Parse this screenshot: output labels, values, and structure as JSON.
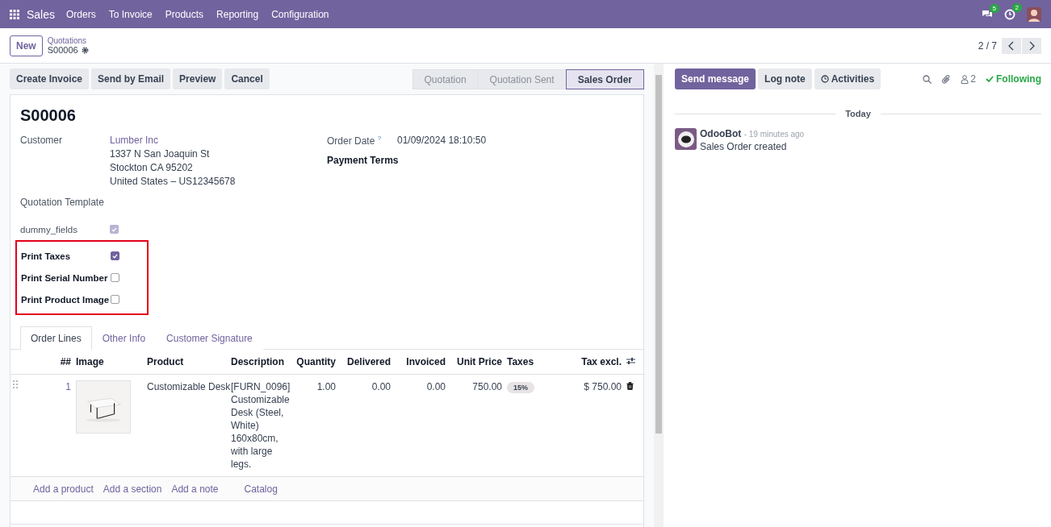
{
  "navbar": {
    "app": "Sales",
    "menu": [
      "Orders",
      "To Invoice",
      "Products",
      "Reporting",
      "Configuration"
    ],
    "messages_badge": "5",
    "activities_badge": "2"
  },
  "control_panel": {
    "new_button": "New",
    "breadcrumb": "Quotations",
    "record": "S00006",
    "pager": "2 / 7"
  },
  "actions": [
    "Create Invoice",
    "Send by Email",
    "Preview",
    "Cancel"
  ],
  "status_bar": [
    {
      "label": "Quotation",
      "selected": false
    },
    {
      "label": "Quotation Sent",
      "selected": false
    },
    {
      "label": "Sales Order",
      "selected": true
    }
  ],
  "form": {
    "title": "S00006",
    "customer": {
      "label": "Customer",
      "name": "Lumber Inc",
      "address": [
        "1337 N San Joaquin St",
        "Stockton CA 95202",
        "United States – US12345678"
      ]
    },
    "order_date": {
      "label": "Order Date",
      "help": "?",
      "value": "01/09/2024 18:10:50"
    },
    "payment_terms": {
      "label": "Payment Terms"
    },
    "quotation_template": {
      "label": "Quotation Template"
    },
    "checkbox_fields": [
      {
        "label": "dummy_fields",
        "checked": true,
        "disabled": true
      }
    ],
    "highlighted_fields": [
      {
        "label": "Print Taxes",
        "checked": true
      },
      {
        "label": "Print Serial Number",
        "checked": false
      },
      {
        "label": "Print Product Image",
        "checked": false
      }
    ],
    "tabs": [
      {
        "label": "Order Lines",
        "selected": true
      },
      {
        "label": "Other Info",
        "selected": false
      },
      {
        "label": "Customer Signature",
        "selected": false
      }
    ],
    "table": {
      "columns": [
        "##",
        "Image",
        "Product",
        "Description",
        "Quantity",
        "Delivered",
        "Invoiced",
        "Unit Price",
        "Taxes",
        "Tax excl."
      ],
      "rows": [
        {
          "number": "1",
          "product": "Customizable Desk",
          "description": "[FURN_0096] Customizable Desk (Steel, White) 160x80cm, with large legs.",
          "quantity": "1.00",
          "delivered": "0.00",
          "invoiced": "0.00",
          "unit_price": "750.00",
          "taxes": "15%",
          "tax_excl": "$ 750.00"
        }
      ],
      "add_links": [
        "Add a product",
        "Add a section",
        "Add a note",
        "Catalog"
      ]
    }
  },
  "chatter": {
    "buttons": [
      {
        "label": "Send message",
        "selected": true
      },
      {
        "label": "Log note",
        "selected": false
      },
      {
        "label": "Activities",
        "selected": false
      }
    ],
    "followers": "2",
    "following": "Following",
    "separator": "Today",
    "messages": [
      {
        "author": "OdooBot",
        "time": "- 19 minutes ago",
        "body": "Sales Order created"
      }
    ]
  }
}
